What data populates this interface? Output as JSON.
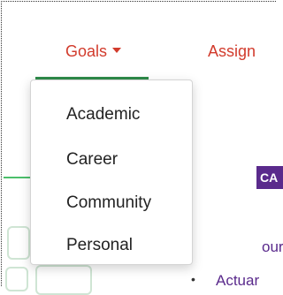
{
  "nav": {
    "tabs": [
      {
        "label": "Goals"
      },
      {
        "label": "Assign"
      }
    ]
  },
  "dropdown": {
    "items": [
      {
        "label": "Academic"
      },
      {
        "label": "Career"
      },
      {
        "label": "Community"
      },
      {
        "label": "Personal"
      }
    ]
  },
  "background": {
    "badge_text": "CA",
    "link_1": "our",
    "link_2": "Actuar",
    "bullet": "•"
  },
  "colors": {
    "tab_text": "#d23b2c",
    "active_underline": "#2e8b4a",
    "badge_bg": "#5a2a8c"
  }
}
